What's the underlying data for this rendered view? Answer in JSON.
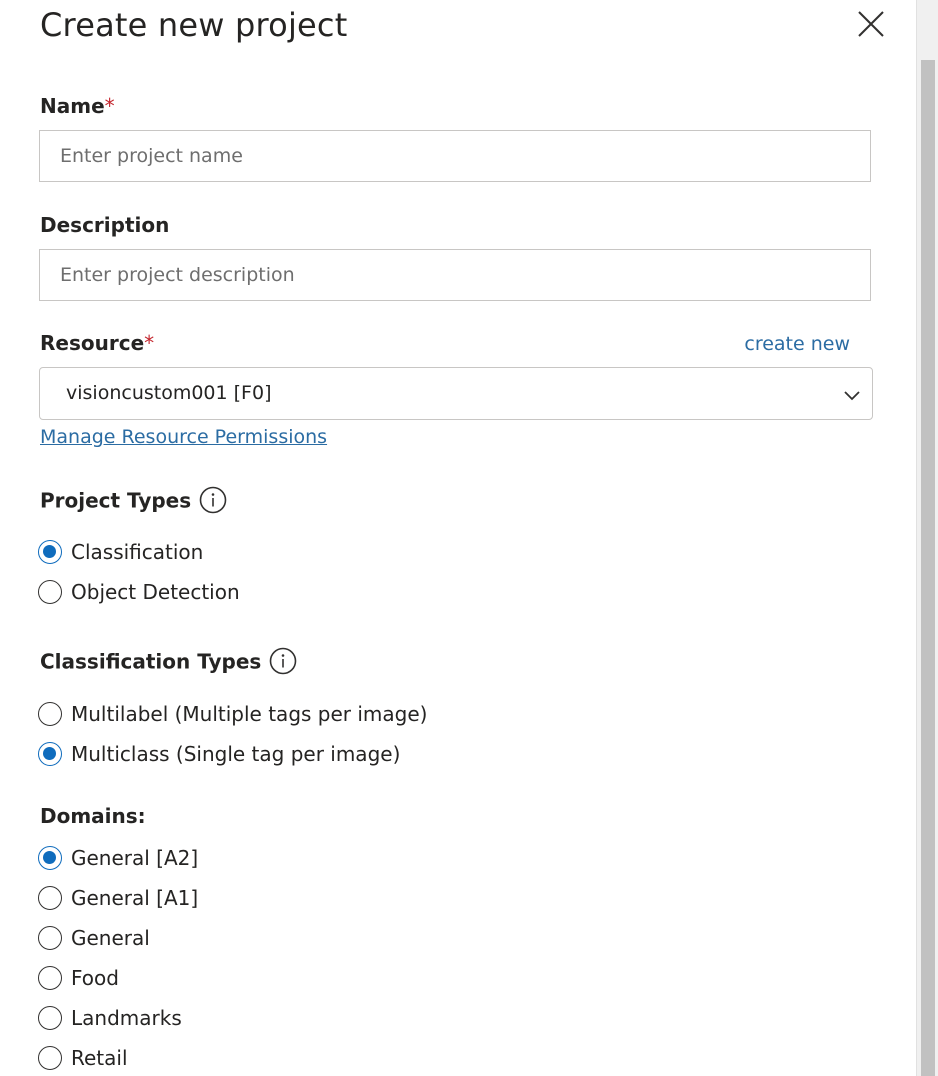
{
  "dialog": {
    "title": "Create new project",
    "name": {
      "label": "Name",
      "required_mark": "*",
      "placeholder": "Enter project name",
      "value": ""
    },
    "description": {
      "label": "Description",
      "placeholder": "Enter project description",
      "value": ""
    },
    "resource": {
      "label": "Resource",
      "required_mark": "*",
      "create_new_label": "create new",
      "selected_value": "visioncustom001 [F0]",
      "manage_permissions_label": "Manage Resource Permissions"
    },
    "project_types": {
      "label": "Project Types",
      "options": [
        {
          "label": "Classification",
          "checked": true
        },
        {
          "label": "Object Detection",
          "checked": false
        }
      ]
    },
    "classification_types": {
      "label": "Classification Types",
      "options": [
        {
          "label": "Multilabel (Multiple tags per image)",
          "checked": false
        },
        {
          "label": "Multiclass (Single tag per image)",
          "checked": true
        }
      ]
    },
    "domains": {
      "label": "Domains:",
      "options": [
        {
          "label": "General [A2]",
          "checked": true
        },
        {
          "label": "General [A1]",
          "checked": false
        },
        {
          "label": "General",
          "checked": false
        },
        {
          "label": "Food",
          "checked": false
        },
        {
          "label": "Landmarks",
          "checked": false
        },
        {
          "label": "Retail",
          "checked": false
        }
      ]
    }
  },
  "colors": {
    "accent": "#0f6cbd",
    "link": "#2b6ca3",
    "required": "#c4262e",
    "text": "#252423"
  },
  "icons": {
    "close": "close-icon",
    "info": "info-icon",
    "dropdown": "chevron-down-icon"
  }
}
